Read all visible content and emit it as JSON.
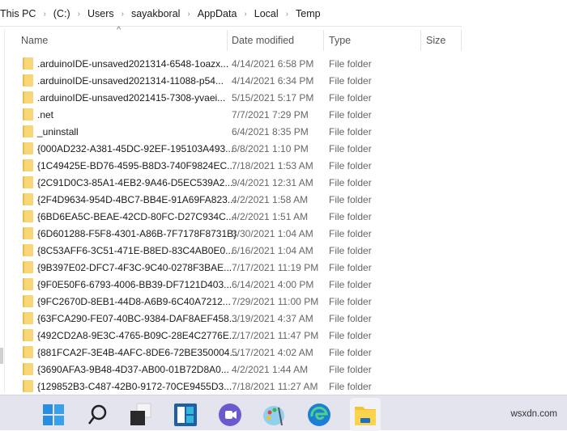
{
  "breadcrumb": [
    "This PC",
    "(C:)",
    "Users",
    "sayakboral",
    "AppData",
    "Local",
    "Temp"
  ],
  "columns": {
    "name": "Name",
    "date": "Date modified",
    "type": "Type",
    "size": "Size"
  },
  "files": [
    {
      "name": ".arduinoIDE-unsaved2021314-6548-1oazx...",
      "date": "4/14/2021 6:58 PM",
      "type": "File folder"
    },
    {
      "name": ".arduinoIDE-unsaved2021314-11088-p54...",
      "date": "4/14/2021 6:34 PM",
      "type": "File folder"
    },
    {
      "name": ".arduinoIDE-unsaved2021415-7308-yvaei...",
      "date": "5/15/2021 5:17 PM",
      "type": "File folder"
    },
    {
      "name": ".net",
      "date": "7/7/2021 7:29 PM",
      "type": "File folder"
    },
    {
      "name": "_uninstall",
      "date": "6/4/2021 8:35 PM",
      "type": "File folder"
    },
    {
      "name": "{000AD232-A381-45DC-92EF-195103A493...",
      "date": "6/8/2021 1:10 PM",
      "type": "File folder"
    },
    {
      "name": "{1C49425E-BD76-4595-B8D3-740F9824EC...",
      "date": "7/18/2021 1:53 AM",
      "type": "File folder"
    },
    {
      "name": "{2C91D0C3-85A1-4EB2-9A46-D5EC539A2...",
      "date": "9/4/2021 12:31 AM",
      "type": "File folder"
    },
    {
      "name": "{2F4D9634-954D-4BC7-BB4E-91A69FA823...",
      "date": "4/2/2021 1:58 AM",
      "type": "File folder"
    },
    {
      "name": "{6BD6EA5C-BEAE-42CD-80FC-D27C934C...",
      "date": "4/2/2021 1:51 AM",
      "type": "File folder"
    },
    {
      "name": "{6D601288-F5F8-4301-A86B-7F7178F8731B}",
      "date": "3/30/2021 1:04 AM",
      "type": "File folder"
    },
    {
      "name": "{8C53AFF6-3C51-471E-B8ED-83C4AB0E0...",
      "date": "6/16/2021 1:04 AM",
      "type": "File folder"
    },
    {
      "name": "{9B397E02-DFC7-4F3C-9C40-0278F3BAE...",
      "date": "7/17/2021 11:19 PM",
      "type": "File folder"
    },
    {
      "name": "{9F0E50F6-6793-4006-BB39-DF7121D403...",
      "date": "6/14/2021 4:00 PM",
      "type": "File folder"
    },
    {
      "name": "{9FC2670D-8EB1-44D8-A6B9-6C40A7212...",
      "date": "7/29/2021 11:00 PM",
      "type": "File folder"
    },
    {
      "name": "{63FCA290-FE07-40BC-9384-DAF8AEF458...",
      "date": "3/19/2021 4:37 AM",
      "type": "File folder"
    },
    {
      "name": "{492CD2A8-9E3C-4765-B09C-28E4C2776E...",
      "date": "7/17/2021 11:47 PM",
      "type": "File folder"
    },
    {
      "name": "{881FCA2F-3E4B-4AFC-8DE6-72BE350004...",
      "date": "5/17/2021 4:02 AM",
      "type": "File folder"
    },
    {
      "name": "{3690AFA3-9B48-4D37-AB00-01B72D8A0...",
      "date": "4/2/2021 1:44 AM",
      "type": "File folder"
    },
    {
      "name": "{129852B3-C487-42B0-9172-70CE9455D3...",
      "date": "7/18/2021 11:27 AM",
      "type": "File folder"
    }
  ],
  "taskbar": [
    "start-icon",
    "search-icon",
    "task-view-icon",
    "widgets-icon",
    "teams-chat-icon",
    "paint-icon",
    "edge-icon",
    "file-explorer-icon"
  ],
  "watermark": "wsxdn.com"
}
